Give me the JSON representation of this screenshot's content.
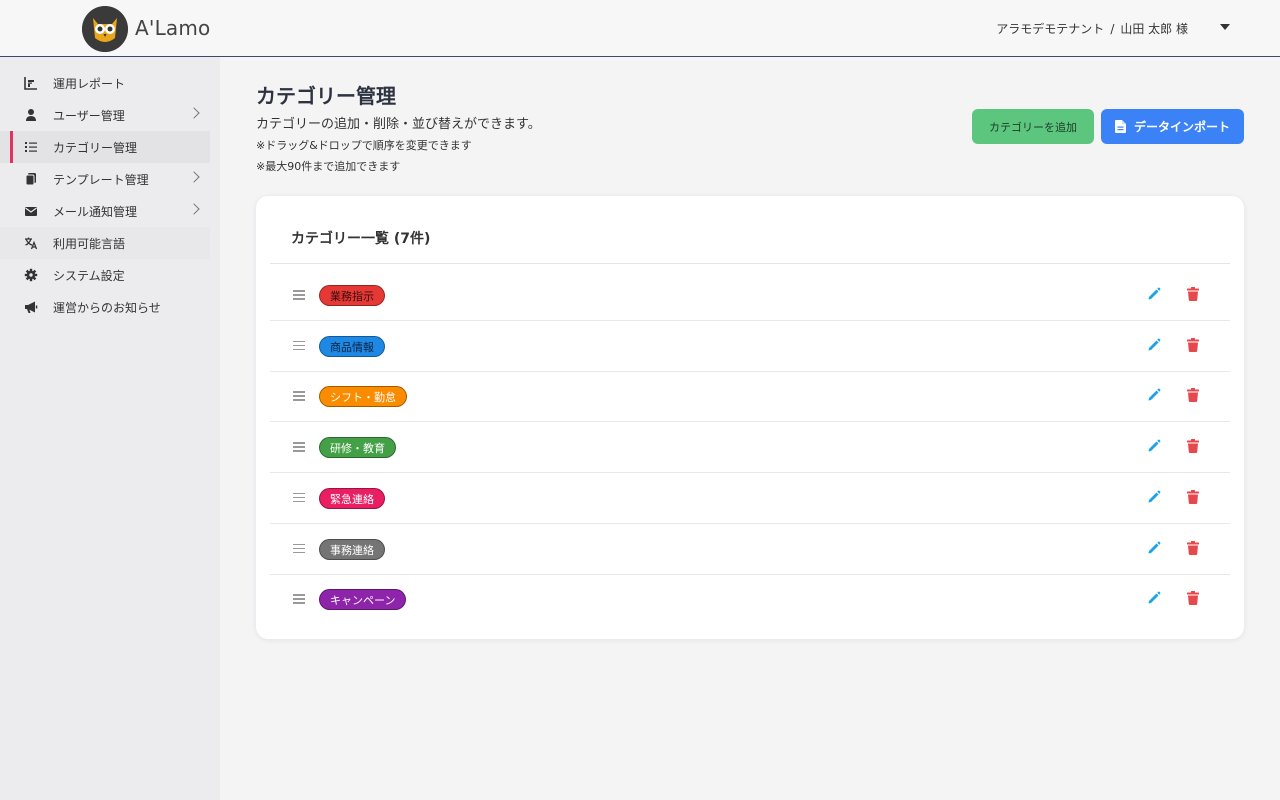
{
  "header": {
    "brand": "A'Lamo",
    "tenant": "アラモデモテナント",
    "separator": "/",
    "user": "山田 太郎 様"
  },
  "sidebar": {
    "items": [
      {
        "label": "運用レポート",
        "icon": "bar-chart-icon",
        "chevron": false
      },
      {
        "label": "ユーザー管理",
        "icon": "user-icon",
        "chevron": true
      },
      {
        "label": "カテゴリー管理",
        "icon": "list-icon",
        "chevron": false,
        "active": true
      },
      {
        "label": "テンプレート管理",
        "icon": "copy-icon",
        "chevron": true
      },
      {
        "label": "メール通知管理",
        "icon": "envelope-icon",
        "chevron": true
      },
      {
        "label": "利用可能言語",
        "icon": "language-icon",
        "chevron": false
      },
      {
        "label": "システム設定",
        "icon": "gear-icon",
        "chevron": false
      },
      {
        "label": "運営からのお知らせ",
        "icon": "megaphone-icon",
        "chevron": false
      }
    ]
  },
  "main": {
    "title": "カテゴリー管理",
    "description": "カテゴリーの追加・削除・並び替えができます。",
    "note1": "※ドラッグ&ドロップで順序を変更できます",
    "note2": "※最大90件まで追加できます",
    "add_button": "カテゴリーを追加",
    "import_button": "データインポート"
  },
  "card": {
    "title": "カテゴリー一覧 (7件)",
    "categories": [
      {
        "label": "業務指示",
        "bg": "#e53935",
        "fg": "#3a0d0d"
      },
      {
        "label": "商品情報",
        "bg": "#1e88e5",
        "fg": "#0d2340"
      },
      {
        "label": "シフト・勤怠",
        "bg": "#fb8c00",
        "fg": "#ffffff"
      },
      {
        "label": "研修・教育",
        "bg": "#43a047",
        "fg": "#ffffff"
      },
      {
        "label": "緊急連絡",
        "bg": "#e91e63",
        "fg": "#ffffff"
      },
      {
        "label": "事務連絡",
        "bg": "#757575",
        "fg": "#ffffff"
      },
      {
        "label": "キャンペーン",
        "bg": "#8e24aa",
        "fg": "#ffffff"
      }
    ]
  },
  "colors": {
    "accent": "#e2325f",
    "add_button": "#5cc57e",
    "import_button": "#3b82f6",
    "edit_icon": "#1aa3e8",
    "delete_icon": "#e5484d"
  }
}
